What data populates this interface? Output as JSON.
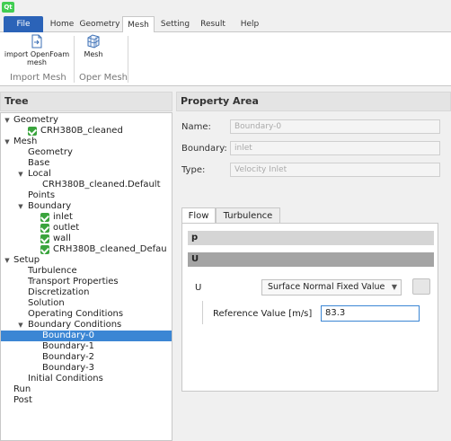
{
  "app": {
    "logo_text": "Qt"
  },
  "tabs": [
    "File",
    "Home",
    "Geometry",
    "Mesh",
    "Setting",
    "Result",
    "Help"
  ],
  "ribbon": {
    "import_openfoam_label": "import OpenFoam mesh",
    "mesh_label": "Mesh",
    "group_import_mesh": "Import Mesh",
    "group_oper_mesh": "Oper Mesh"
  },
  "tree": {
    "title": "Tree",
    "items": [
      "Geometry",
      "CRH380B_cleaned",
      "Mesh",
      "Geometry",
      "Base",
      "Local",
      "CRH380B_cleaned.Default",
      "Points",
      "Boundary",
      "inlet",
      "outlet",
      "wall",
      "CRH380B_cleaned_Defau",
      "Setup",
      "Turbulence",
      "Transport Properties",
      "Discretization",
      "Solution",
      "Operating Conditions",
      "Boundary Conditions",
      "Boundary-0",
      "Boundary-1",
      "Boundary-2",
      "Boundary-3",
      "Initial Conditions",
      "Run",
      "Post"
    ],
    "selected": "Boundary-0"
  },
  "property": {
    "title": "Property Area",
    "name_label": "Name:",
    "name_value": "Boundary-0",
    "boundary_label": "Boundary:",
    "boundary_value": "inlet",
    "type_label": "Type:",
    "type_value": "Velocity Inlet",
    "tab_flow": "Flow",
    "tab_turbulence": "Turbulence",
    "section_p": "p",
    "section_u": "U",
    "u_label": "U",
    "u_mode": "Surface Normal Fixed Value",
    "ref_label": "Reference Value [m/s]",
    "ref_value": "83.3"
  },
  "colors": {
    "accent": "#2b63b8",
    "selection": "#3b86d4",
    "checkbox": "#3aa43d"
  }
}
